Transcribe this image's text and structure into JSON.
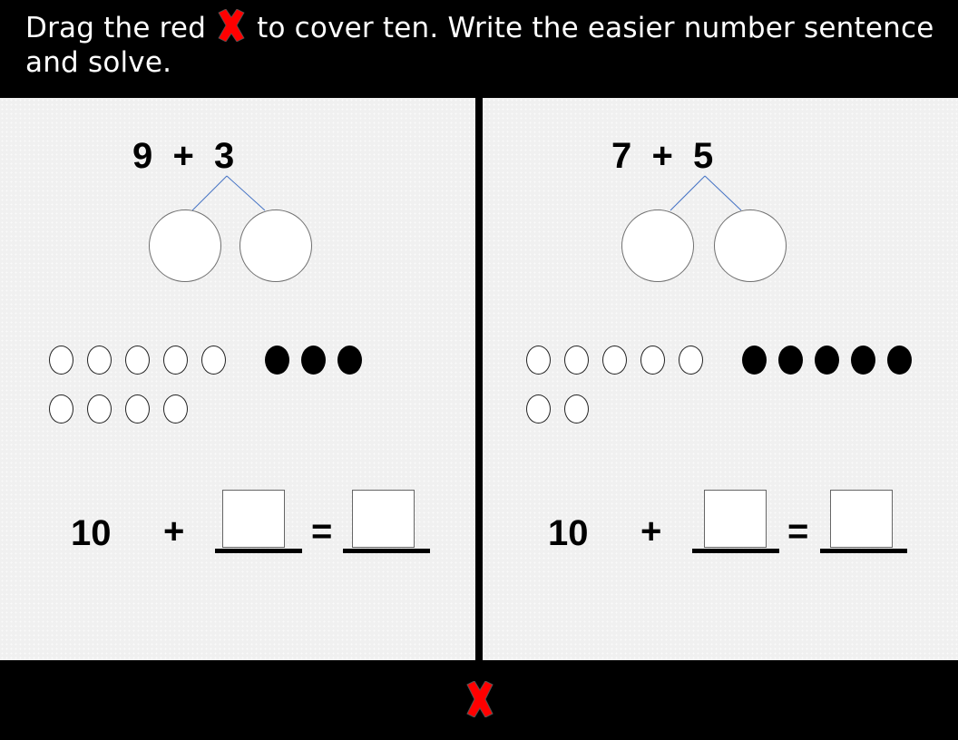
{
  "header": {
    "instruction_part1": "Drag the red",
    "instruction_icon": "red-x-icon",
    "instruction_part2": "to cover ten.  Write the easier number sentence and solve."
  },
  "colors": {
    "background": "#000000",
    "panel": "#f0f0f0",
    "header_text": "#ffffff",
    "red_x": "#ff0000",
    "bond_line": "#4472c4"
  },
  "problems": [
    {
      "equation": "9  +  3",
      "addend1": 9,
      "addend2": 3,
      "open_counters": 9,
      "filled_counters": 3,
      "sentence": {
        "ten": "10",
        "plus": "+",
        "equals": "=",
        "blank1": "",
        "blank2": ""
      }
    },
    {
      "equation": "7  +  5",
      "addend1": 7,
      "addend2": 5,
      "open_counters": 7,
      "filled_counters": 5,
      "sentence": {
        "ten": "10",
        "plus": "+",
        "equals": "=",
        "blank1": "",
        "blank2": ""
      }
    }
  ],
  "footer": {
    "draggable_icon": "red-x-icon"
  }
}
